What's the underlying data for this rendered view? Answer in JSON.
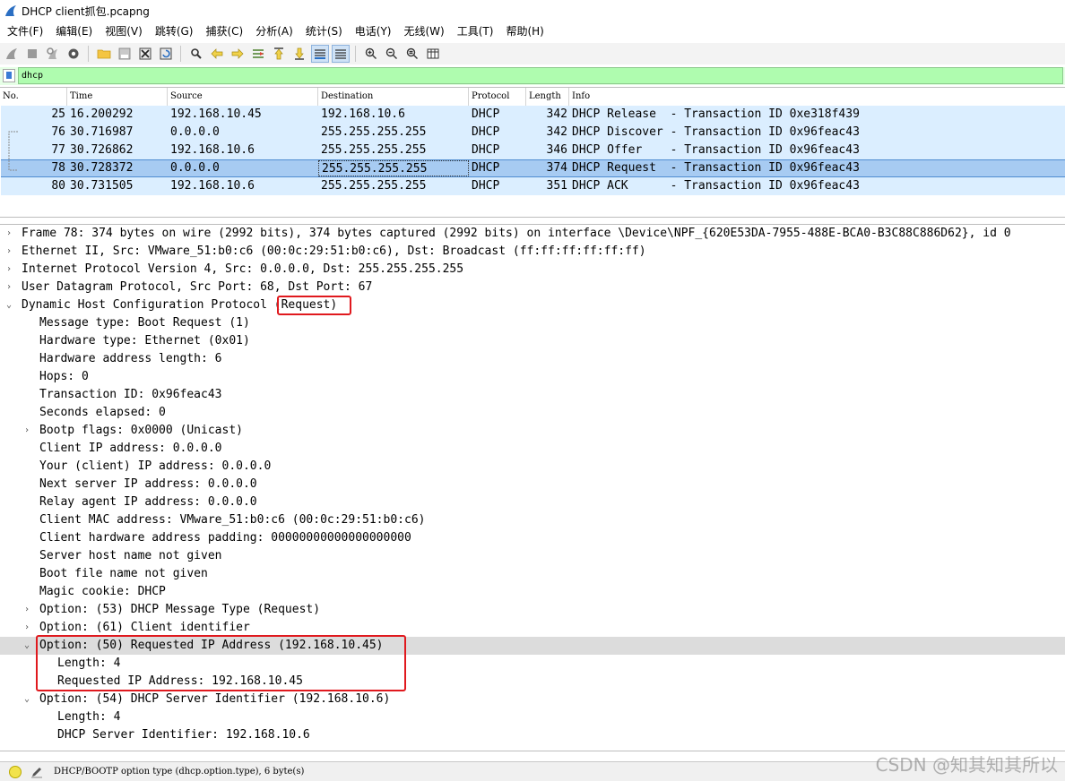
{
  "window": {
    "title": "DHCP client抓包.pcapng"
  },
  "menu": [
    "文件(F)",
    "编辑(E)",
    "视图(V)",
    "跳转(G)",
    "捕获(C)",
    "分析(A)",
    "统计(S)",
    "电话(Y)",
    "无线(W)",
    "工具(T)",
    "帮助(H)"
  ],
  "filter": {
    "value": "dhcp"
  },
  "packet_list": {
    "columns": [
      "No.",
      "Time",
      "Source",
      "Destination",
      "Protocol",
      "Length",
      "Info"
    ],
    "rows": [
      {
        "no": "25",
        "time": "16.200292",
        "src": "192.168.10.45",
        "dst": "192.168.10.6",
        "proto": "DHCP",
        "len": "342",
        "info": "DHCP Release  - Transaction ID 0xe318f439"
      },
      {
        "no": "76",
        "time": "30.716987",
        "src": "0.0.0.0",
        "dst": "255.255.255.255",
        "proto": "DHCP",
        "len": "342",
        "info": "DHCP Discover - Transaction ID 0x96feac43"
      },
      {
        "no": "77",
        "time": "30.726862",
        "src": "192.168.10.6",
        "dst": "255.255.255.255",
        "proto": "DHCP",
        "len": "346",
        "info": "DHCP Offer    - Transaction ID 0x96feac43"
      },
      {
        "no": "78",
        "time": "30.728372",
        "src": "0.0.0.0",
        "dst": "255.255.255.255",
        "proto": "DHCP",
        "len": "374",
        "info": "DHCP Request  - Transaction ID 0x96feac43"
      },
      {
        "no": "80",
        "time": "30.731505",
        "src": "192.168.10.6",
        "dst": "255.255.255.255",
        "proto": "DHCP",
        "len": "351",
        "info": "DHCP ACK      - Transaction ID 0x96feac43"
      }
    ]
  },
  "details": {
    "frame": "Frame 78: 374 bytes on wire (2992 bits), 374 bytes captured (2992 bits) on interface \\Device\\NPF_{620E53DA-7955-488E-BCA0-B3C88C886D62}, id 0",
    "ethernet": "Ethernet II, Src: VMware_51:b0:c6 (00:0c:29:51:b0:c6), Dst: Broadcast (ff:ff:ff:ff:ff:ff)",
    "ip": "Internet Protocol Version 4, Src: 0.0.0.0, Dst: 255.255.255.255",
    "udp": "User Datagram Protocol, Src Port: 68, Dst Port: 67",
    "dhcp": "Dynamic Host Configuration Protocol (Request)",
    "msg_type": "Message type: Boot Request (1)",
    "hw_type": "Hardware type: Ethernet (0x01)",
    "hw_len": "Hardware address length: 6",
    "hops": "Hops: 0",
    "xid": "Transaction ID: 0x96feac43",
    "secs": "Seconds elapsed: 0",
    "flags": "Bootp flags: 0x0000 (Unicast)",
    "ciaddr": "Client IP address: 0.0.0.0",
    "yiaddr": "Your (client) IP address: 0.0.0.0",
    "siaddr": "Next server IP address: 0.0.0.0",
    "giaddr": "Relay agent IP address: 0.0.0.0",
    "chaddr": "Client MAC address: VMware_51:b0:c6 (00:0c:29:51:b0:c6)",
    "padding": "Client hardware address padding: 00000000000000000000",
    "sname": "Server host name not given",
    "file": "Boot file name not given",
    "cookie": "Magic cookie: DHCP",
    "opt53": "Option: (53) DHCP Message Type (Request)",
    "opt61": "Option: (61) Client identifier",
    "opt50": "Option: (50) Requested IP Address (192.168.10.45)",
    "opt50_len": "Length: 4",
    "opt50_val": "Requested IP Address: 192.168.10.45",
    "opt54": "Option: (54) DHCP Server Identifier (192.168.10.6)",
    "opt54_len": "Length: 4",
    "opt54_val": "DHCP Server Identifier: 192.168.10.6"
  },
  "status": {
    "text": "DHCP/BOOTP option type (dhcp.option.type), 6 byte(s)"
  },
  "watermark": "CSDN @知其知其所以"
}
